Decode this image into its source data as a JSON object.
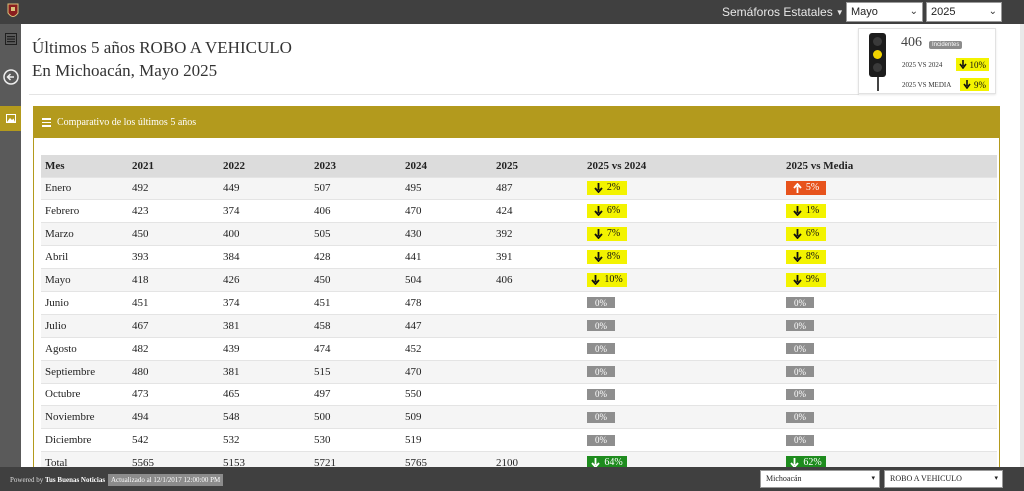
{
  "topbar": {
    "state_menu": "Semáforos Estatales",
    "month_select": "Mayo",
    "year_select": "2025"
  },
  "header": {
    "title_line1": "Últimos 5 años ROBO A VEHICULO",
    "title_line2": "En Michoacán, Mayo 2025"
  },
  "semaforo": {
    "count": "406",
    "count_label": "Incidentes",
    "vs_year_label": "2025 VS 2024",
    "vs_year_value": "10%",
    "vs_media_label": "2025 VS MEDIA",
    "vs_media_value": "9%"
  },
  "section": {
    "title": "Comparativo de los últimos 5 años"
  },
  "table": {
    "columns": [
      "Mes",
      "2021",
      "2022",
      "2023",
      "2024",
      "2025",
      "2025 vs 2024",
      "2025 vs Media"
    ],
    "rows": [
      {
        "mes": "Enero",
        "y2021": "492",
        "y2022": "449",
        "y2023": "507",
        "y2024": "495",
        "y2025": "487",
        "vs2024": "2%",
        "vs2024_type": "y",
        "vs2024_dir": "down",
        "vsmedia": "5%",
        "vsmedia_type": "o",
        "vsmedia_dir": "up"
      },
      {
        "mes": "Febrero",
        "y2021": "423",
        "y2022": "374",
        "y2023": "406",
        "y2024": "470",
        "y2025": "424",
        "vs2024": "6%",
        "vs2024_type": "y",
        "vs2024_dir": "down",
        "vsmedia": "1%",
        "vsmedia_type": "y",
        "vsmedia_dir": "down"
      },
      {
        "mes": "Marzo",
        "y2021": "450",
        "y2022": "400",
        "y2023": "505",
        "y2024": "430",
        "y2025": "392",
        "vs2024": "7%",
        "vs2024_type": "y",
        "vs2024_dir": "down",
        "vsmedia": "6%",
        "vsmedia_type": "y",
        "vsmedia_dir": "down"
      },
      {
        "mes": "Abril",
        "y2021": "393",
        "y2022": "384",
        "y2023": "428",
        "y2024": "441",
        "y2025": "391",
        "vs2024": "8%",
        "vs2024_type": "y",
        "vs2024_dir": "down",
        "vsmedia": "8%",
        "vsmedia_type": "y",
        "vsmedia_dir": "down"
      },
      {
        "mes": "Mayo",
        "y2021": "418",
        "y2022": "426",
        "y2023": "450",
        "y2024": "504",
        "y2025": "406",
        "vs2024": "10%",
        "vs2024_type": "y",
        "vs2024_dir": "down",
        "vsmedia": "9%",
        "vsmedia_type": "y",
        "vsmedia_dir": "down"
      },
      {
        "mes": "Junio",
        "y2021": "451",
        "y2022": "374",
        "y2023": "451",
        "y2024": "478",
        "y2025": "",
        "vs2024": "0%",
        "vs2024_type": "g",
        "vs2024_dir": "",
        "vsmedia": "0%",
        "vsmedia_type": "g",
        "vsmedia_dir": ""
      },
      {
        "mes": "Julio",
        "y2021": "467",
        "y2022": "381",
        "y2023": "458",
        "y2024": "447",
        "y2025": "",
        "vs2024": "0%",
        "vs2024_type": "g",
        "vs2024_dir": "",
        "vsmedia": "0%",
        "vsmedia_type": "g",
        "vsmedia_dir": ""
      },
      {
        "mes": "Agosto",
        "y2021": "482",
        "y2022": "439",
        "y2023": "474",
        "y2024": "452",
        "y2025": "",
        "vs2024": "0%",
        "vs2024_type": "g",
        "vs2024_dir": "",
        "vsmedia": "0%",
        "vsmedia_type": "g",
        "vsmedia_dir": ""
      },
      {
        "mes": "Septiembre",
        "y2021": "480",
        "y2022": "381",
        "y2023": "515",
        "y2024": "470",
        "y2025": "",
        "vs2024": "0%",
        "vs2024_type": "g",
        "vs2024_dir": "",
        "vsmedia": "0%",
        "vsmedia_type": "g",
        "vsmedia_dir": ""
      },
      {
        "mes": "Octubre",
        "y2021": "473",
        "y2022": "465",
        "y2023": "497",
        "y2024": "550",
        "y2025": "",
        "vs2024": "0%",
        "vs2024_type": "g",
        "vs2024_dir": "",
        "vsmedia": "0%",
        "vsmedia_type": "g",
        "vsmedia_dir": ""
      },
      {
        "mes": "Noviembre",
        "y2021": "494",
        "y2022": "548",
        "y2023": "500",
        "y2024": "509",
        "y2025": "",
        "vs2024": "0%",
        "vs2024_type": "g",
        "vs2024_dir": "",
        "vsmedia": "0%",
        "vsmedia_type": "g",
        "vsmedia_dir": ""
      },
      {
        "mes": "Diciembre",
        "y2021": "542",
        "y2022": "532",
        "y2023": "530",
        "y2024": "519",
        "y2025": "",
        "vs2024": "0%",
        "vs2024_type": "g",
        "vs2024_dir": "",
        "vsmedia": "0%",
        "vsmedia_type": "g",
        "vsmedia_dir": ""
      },
      {
        "mes": "Total",
        "y2021": "5565",
        "y2022": "5153",
        "y2023": "5721",
        "y2024": "5765",
        "y2025": "2100",
        "vs2024": "64%",
        "vs2024_type": "gr",
        "vs2024_dir": "down",
        "vsmedia": "62%",
        "vsmedia_type": "gr",
        "vsmedia_dir": "down"
      }
    ]
  },
  "footer": {
    "powered_prefix": "Powered by",
    "powered_brand": "Tus Buenas Noticias",
    "updated": "Actualizado al 12/1/2017 12:00:00 PM",
    "state_select": "Michoacán",
    "crime_select": "ROBO A VEHICULO"
  },
  "colors": {
    "accent": "#b39a1d",
    "bar_dark": "#404040",
    "badge_yellow": "#f3f300",
    "badge_orange": "#e7531c",
    "badge_green": "#1e8c1e",
    "badge_gray": "#8e8e8e"
  },
  "icons": {
    "down": "arrow-down-icon",
    "up": "arrow-up-icon"
  }
}
